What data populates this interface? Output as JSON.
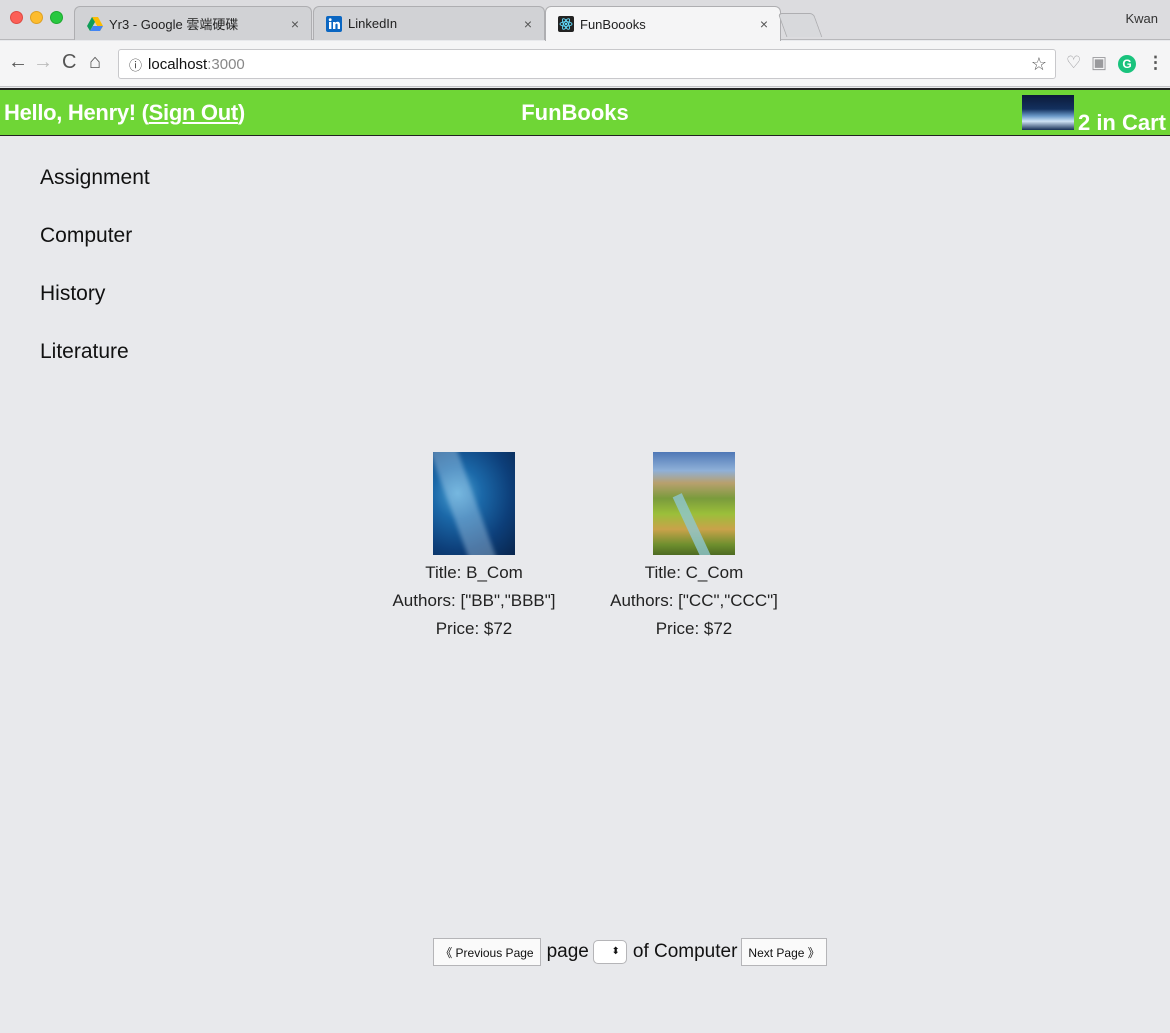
{
  "browser": {
    "tabs": [
      {
        "title": "Yr3 - Google 雲端硬碟",
        "icon": "google-drive-icon",
        "close": "×"
      },
      {
        "title": "LinkedIn",
        "icon": "linkedin-icon",
        "close": "×"
      },
      {
        "title": "FunBoooks",
        "icon": "react-icon",
        "close": "×",
        "active": true
      }
    ],
    "profile_name": "Kwan",
    "url_host": "localhost",
    "url_port": ":3000"
  },
  "header": {
    "greeting": "Hello, Henry! ",
    "signout_open": "(",
    "signout_label": "Sign Out",
    "signout_close": ")",
    "brand": "FunBooks",
    "cart_label": "2 in Cart",
    "color": "#6fd636"
  },
  "categories": [
    "Assignment",
    "Computer",
    "History",
    "Literature"
  ],
  "books": [
    {
      "title": "Title: B_Com",
      "authors": "Authors: [\"BB\",\"BBB\"]",
      "price": "Price: $72"
    },
    {
      "title": "Title: C_Com",
      "authors": "Authors: [\"CC\",\"CCC\"]",
      "price": "Price: $72"
    }
  ],
  "pagination": {
    "prev_label": "《 Previous Page",
    "page_word": "page",
    "of_text": "of Computer",
    "next_label": "Next Page 》",
    "select_value": ""
  }
}
